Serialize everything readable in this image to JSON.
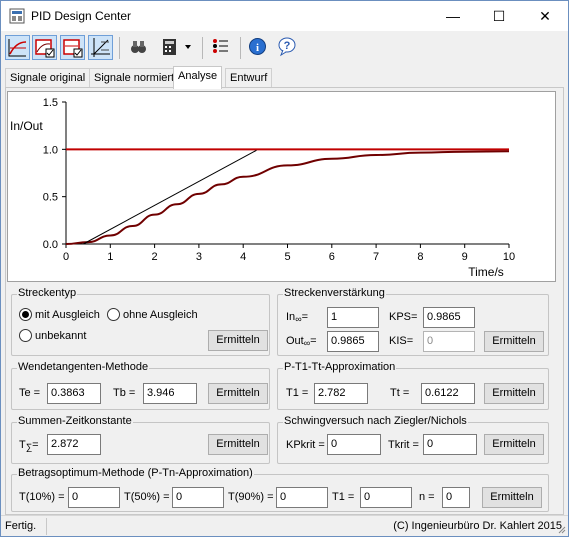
{
  "window": {
    "title": "PID Design Center"
  },
  "controls": {
    "minimize": "—",
    "maximize": "☐",
    "close": "✕"
  },
  "toolbar": {
    "icons": [
      "chart-line-icon",
      "chart-check-icon-1",
      "chart-check-icon-2",
      "chart-axis-icon",
      "binoculars-icon",
      "calculator-icon",
      "dropdown-arrow-icon",
      "list-icon",
      "info-icon",
      "help-icon"
    ]
  },
  "tabs": [
    "Signale original",
    "Signale normiert",
    "Analyse",
    "Entwurf"
  ],
  "chart_data": {
    "type": "line",
    "ylabel": "In/Out",
    "xlabel": "Time/s",
    "xlim": [
      0,
      10
    ],
    "ylim": [
      0,
      1.5
    ],
    "xticks": [
      "0",
      "1",
      "2",
      "3",
      "4",
      "5",
      "6",
      "7",
      "8",
      "9",
      "10"
    ],
    "yticks": [
      "0.0",
      "0.5",
      "1.0",
      "1.5"
    ],
    "series": [
      {
        "kind": "step",
        "color": "#c00000",
        "values": [
          {
            "x": 0,
            "y": 1.0
          },
          {
            "x": 10,
            "y": 1.0
          }
        ]
      },
      {
        "kind": "response",
        "color": "#700000",
        "values": [
          {
            "x": 0,
            "y": 0
          },
          {
            "x": 0.5,
            "y": 0.02
          },
          {
            "x": 1,
            "y": 0.09
          },
          {
            "x": 1.5,
            "y": 0.19
          },
          {
            "x": 2,
            "y": 0.31
          },
          {
            "x": 2.5,
            "y": 0.42
          },
          {
            "x": 3,
            "y": 0.53
          },
          {
            "x": 3.5,
            "y": 0.63
          },
          {
            "x": 4,
            "y": 0.71
          },
          {
            "x": 5,
            "y": 0.83
          },
          {
            "x": 6,
            "y": 0.9
          },
          {
            "x": 7,
            "y": 0.94
          },
          {
            "x": 8,
            "y": 0.965
          },
          {
            "x": 9,
            "y": 0.975
          },
          {
            "x": 10,
            "y": 0.98
          }
        ]
      },
      {
        "kind": "tangent",
        "color": "#000000",
        "values": [
          {
            "x": 0.39,
            "y": 0
          },
          {
            "x": 4.3,
            "y": 0.99
          }
        ]
      }
    ]
  },
  "streckentyp": {
    "title": "Streckentyp",
    "opt1": "mit Ausgleich",
    "opt2": "ohne Ausgleich",
    "opt3": "unbekannt",
    "button": "Ermitteln"
  },
  "verstaerkung": {
    "title": "Streckenverstärkung",
    "in_label": "In",
    "in_sub": "∞",
    "in_eq": "=",
    "in_value": "1",
    "out_label": "Out",
    "out_sub": "∞",
    "out_eq": "=",
    "out_value": "0.9865",
    "kps_label": "KPS=",
    "kps_value": "0.9865",
    "kis_label": "KIS=",
    "kis_value": "0",
    "button": "Ermitteln"
  },
  "wendetangente": {
    "title": "Wendetangenten-Methode",
    "te_label": "Te  =",
    "te_value": "0.3863",
    "tb_label": "Tb  =",
    "tb_value": "3.946",
    "button": "Ermitteln"
  },
  "pt1tt": {
    "title": "P-T1-Tt-Approximation",
    "t1_label": "T1  =",
    "t1_value": "2.782",
    "tt_label": "Tt  =",
    "tt_value": "0.6122",
    "button": "Ermitteln"
  },
  "summen": {
    "title": "Summen-Zeitkonstante",
    "t_label": "T",
    "t_sub": "∑",
    "t_eq": "=",
    "t_value": "2.872",
    "button": "Ermitteln"
  },
  "schwing": {
    "title": "Schwingversuch nach Ziegler/Nichols",
    "kp_label": "KPkrit =",
    "kp_value": "0",
    "tk_label": "Tkrit =",
    "tk_value": "0",
    "button": "Ermitteln"
  },
  "betrag": {
    "title": "Betragsoptimum-Methode (P-Tn-Approximation)",
    "t10_label": "T(10%) =",
    "t10_value": "0",
    "t50_label": "T(50%) =",
    "t50_value": "0",
    "t90_label": "T(90%) =",
    "t90_value": "0",
    "t1_label": "T1  =",
    "t1_value": "0",
    "n_label": "n  =",
    "n_value": "0",
    "button": "Ermitteln"
  },
  "status": {
    "left": "Fertig.",
    "right": "(C) Ingenieurbüro Dr. Kahlert 2015"
  }
}
